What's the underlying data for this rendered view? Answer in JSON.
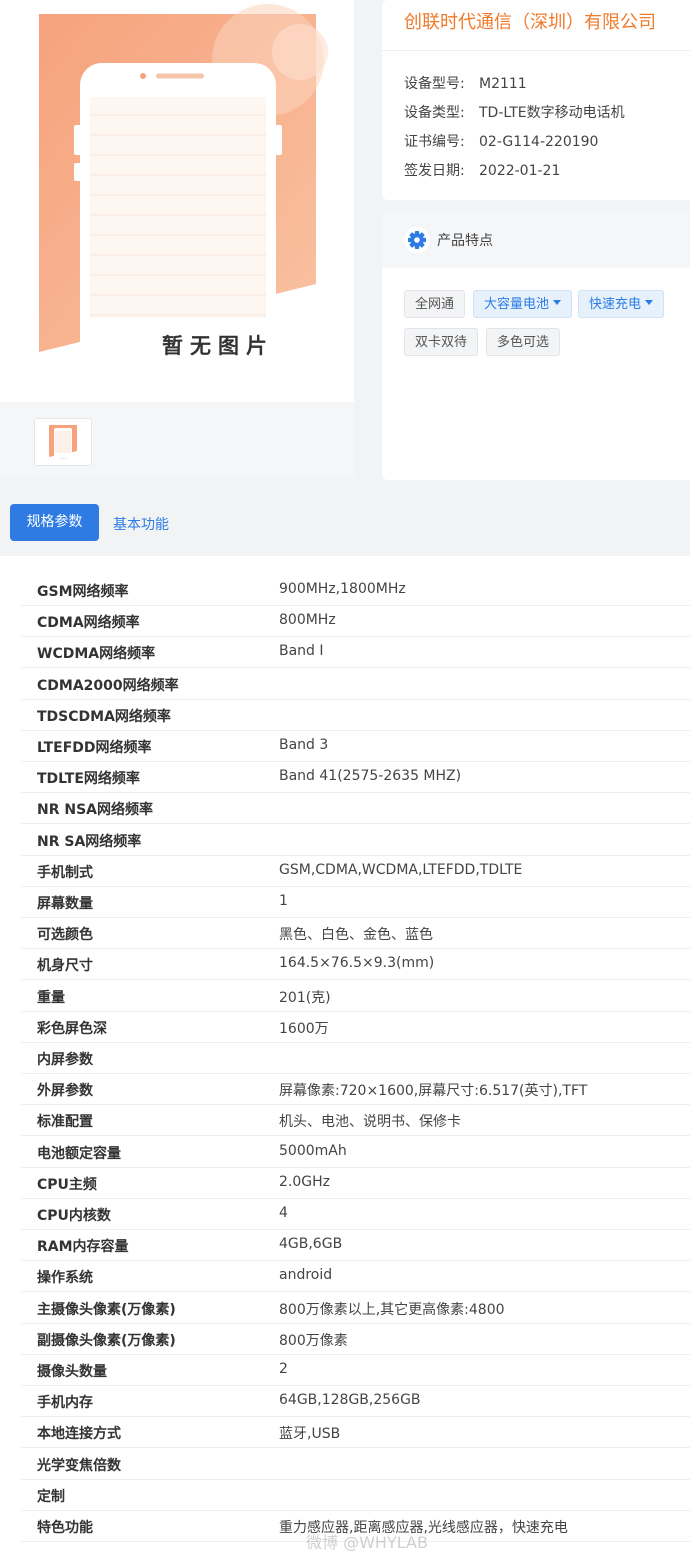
{
  "product": {
    "placeholder_text": "暂无图片",
    "placeholder_thumb_text": "......"
  },
  "info": {
    "company": "创联时代通信（深圳）有限公司",
    "rows": [
      {
        "key": "设备型号:",
        "value": "M2111"
      },
      {
        "key": "设备类型:",
        "value": "TD-LTE数字移动电话机"
      },
      {
        "key": "证书编号:",
        "value": "02-G114-220190"
      },
      {
        "key": "签发日期:",
        "value": "2022-01-21"
      }
    ]
  },
  "features": {
    "title": "产品特点",
    "tags": [
      {
        "label": "全网通",
        "style": "grey",
        "dropdown": false
      },
      {
        "label": "大容量电池",
        "style": "blue",
        "dropdown": true
      },
      {
        "label": "快速充电",
        "style": "blue",
        "dropdown": true
      },
      {
        "label": "双卡双待",
        "style": "grey",
        "dropdown": false
      },
      {
        "label": "多色可选",
        "style": "grey",
        "dropdown": false
      }
    ]
  },
  "tabs": {
    "active": "规格参数",
    "other": "基本功能"
  },
  "specs": [
    {
      "key": "GSM网络频率",
      "value": "900MHz,1800MHz"
    },
    {
      "key": "CDMA网络频率",
      "value": "800MHz"
    },
    {
      "key": "WCDMA网络频率",
      "value": "Band I"
    },
    {
      "key": "CDMA2000网络频率",
      "value": ""
    },
    {
      "key": "TDSCDMA网络频率",
      "value": ""
    },
    {
      "key": "LTEFDD网络频率",
      "value": "Band 3"
    },
    {
      "key": "TDLTE网络频率",
      "value": "Band 41(2575-2635 MHZ)"
    },
    {
      "key": "NR NSA网络频率",
      "value": ""
    },
    {
      "key": "NR SA网络频率",
      "value": ""
    },
    {
      "key": "手机制式",
      "value": "GSM,CDMA,WCDMA,LTEFDD,TDLTE"
    },
    {
      "key": "屏幕数量",
      "value": "1"
    },
    {
      "key": "可选颜色",
      "value": "黑色、白色、金色、蓝色"
    },
    {
      "key": "机身尺寸",
      "value": "164.5×76.5×9.3(mm)"
    },
    {
      "key": "重量",
      "value": "201(克)"
    },
    {
      "key": "彩色屏色深",
      "value": "1600万"
    },
    {
      "key": "内屏参数",
      "value": ""
    },
    {
      "key": "外屏参数",
      "value": "屏幕像素:720×1600,屏幕尺寸:6.517(英寸),TFT"
    },
    {
      "key": "标准配置",
      "value": "机头、电池、说明书、保修卡"
    },
    {
      "key": "电池额定容量",
      "value": "5000mAh"
    },
    {
      "key": "CPU主频",
      "value": "2.0GHz"
    },
    {
      "key": "CPU内核数",
      "value": "4"
    },
    {
      "key": "RAM内存容量",
      "value": "4GB,6GB"
    },
    {
      "key": "操作系统",
      "value": "android"
    },
    {
      "key": "主摄像头像素(万像素)",
      "value": "800万像素以上,其它更高像素:4800"
    },
    {
      "key": "副摄像头像素(万像素)",
      "value": "800万像素"
    },
    {
      "key": "摄像头数量",
      "value": "2"
    },
    {
      "key": "手机内存",
      "value": "64GB,128GB,256GB"
    },
    {
      "key": "本地连接方式",
      "value": "蓝牙,USB"
    },
    {
      "key": "光学变焦倍数",
      "value": ""
    },
    {
      "key": "定制",
      "value": ""
    },
    {
      "key": "特色功能",
      "value": "重力感应器,距离感应器,光线感应器，快速充电"
    }
  ],
  "watermark": "微博 @WHYLAB",
  "colors": {
    "accent_blue": "#2d7be3",
    "company_orange": "#f27a2b",
    "placeholder_orange": "#f7a783"
  }
}
